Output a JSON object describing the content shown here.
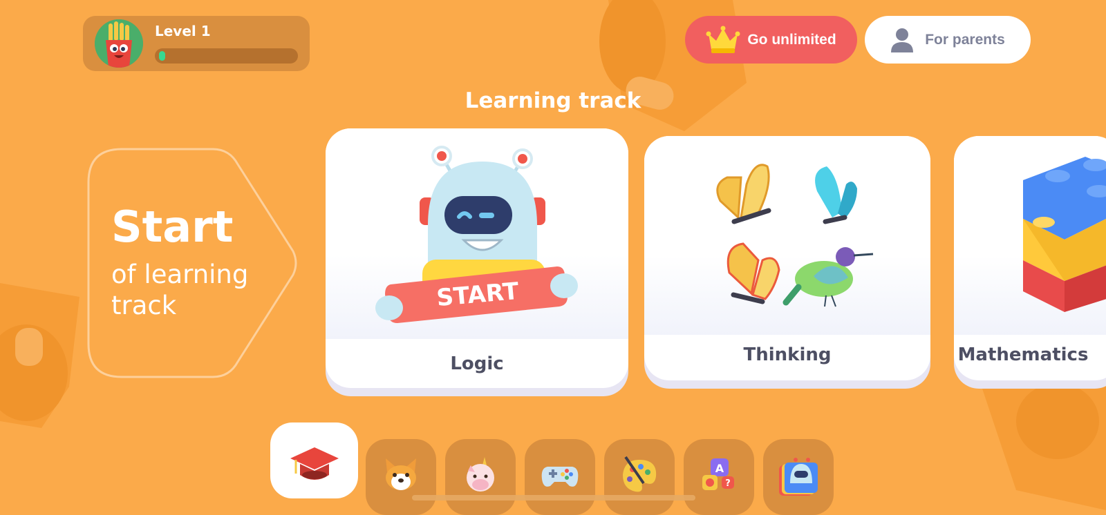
{
  "profile": {
    "level_label": "Level 1",
    "progress_fraction": 0.03
  },
  "header": {
    "unlimited_label": "Go unlimited",
    "parents_label": "For parents"
  },
  "learning": {
    "section_title": "Learning track",
    "start_title": "Start",
    "start_subtitle": "of learning track",
    "cards": [
      {
        "label": "Logic",
        "badge_text": "START"
      },
      {
        "label": "Thinking"
      },
      {
        "label": "Mathematics"
      }
    ]
  },
  "nav": {
    "tabs": [
      {
        "icon": "graduation-cap-icon",
        "active": true
      },
      {
        "icon": "corgi-icon",
        "active": false
      },
      {
        "icon": "unicorn-icon",
        "active": false
      },
      {
        "icon": "gamepad-icon",
        "active": false
      },
      {
        "icon": "palette-icon",
        "active": false
      },
      {
        "icon": "letters-quiz-icon",
        "active": false
      },
      {
        "icon": "robot-books-icon",
        "active": false
      }
    ]
  },
  "colors": {
    "background": "#FBAA4A",
    "accent_red": "#F15F5F",
    "text_dark": "#4D4F63",
    "panel_dark": "#D98F3F"
  }
}
